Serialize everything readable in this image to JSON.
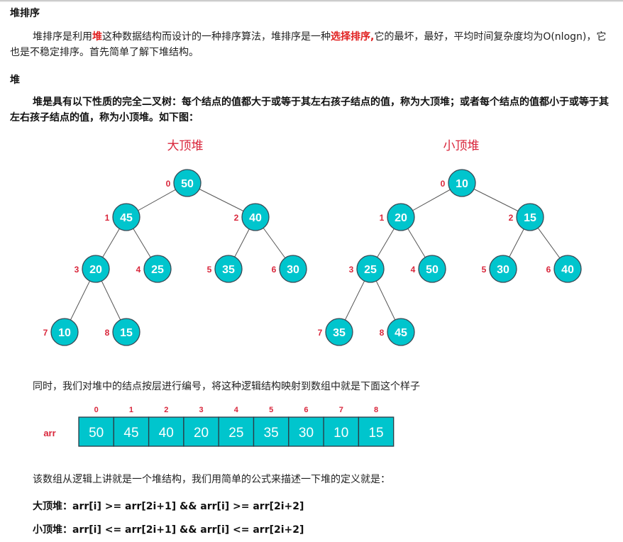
{
  "section1": {
    "title": "堆排序",
    "p1_a": "堆排序是利用",
    "p1_heap": "堆",
    "p1_b": "这种数据结构而设计的一种排序算法，堆排序是一种",
    "p1_sel": "选择排序,",
    "p1_c": "它的最坏，最好，平均时间复杂度均为O(nlogn)，它也是不稳定排序。首先简单了解下堆结构。"
  },
  "section2": {
    "title": "堆",
    "def": "堆是具有以下性质的完全二叉树：每个结点的值都大于或等于其左右孩子结点的值，称为大顶堆；或者每个结点的值都小于或等于其左右孩子结点的值，称为小顶堆。如下图："
  },
  "trees": [
    {
      "title": "大顶堆",
      "values": [
        50,
        45,
        40,
        20,
        25,
        35,
        30,
        10,
        15
      ]
    },
    {
      "title": "小顶堆",
      "values": [
        10,
        20,
        15,
        25,
        50,
        30,
        40,
        35,
        45
      ]
    }
  ],
  "indices": [
    "0",
    "1",
    "2",
    "3",
    "4",
    "5",
    "6",
    "7",
    "8"
  ],
  "array_intro": "同时，我们对堆中的结点按层进行编号，将这种逻辑结构映射到数组中就是下面这个样子",
  "array": {
    "label": "arr",
    "values": [
      50,
      45,
      40,
      20,
      25,
      35,
      30,
      10,
      15
    ]
  },
  "summary": "该数组从逻辑上讲就是一个堆结构，我们用简单的公式来描述一下堆的定义就是：",
  "formulas": [
    {
      "label": "大顶堆：",
      "expr": "arr[i] >= arr[2i+1] && arr[i] >= arr[2i+2]"
    },
    {
      "label": "小顶堆：",
      "expr": "arr[i] <= arr[2i+1] && arr[i] <= arr[2i+2]"
    }
  ],
  "colors": {
    "node": "#00c5cd",
    "red": "#e02020",
    "label_red": "#d9263b"
  }
}
